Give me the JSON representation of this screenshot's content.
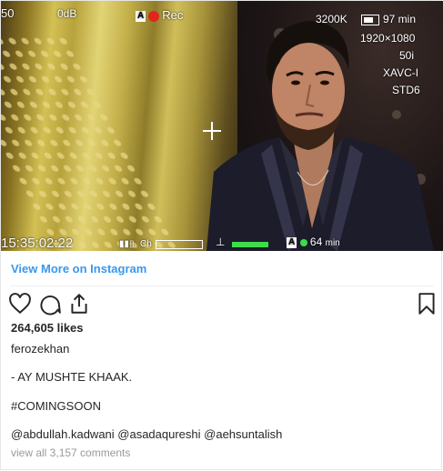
{
  "hud": {
    "top_left_value": "50",
    "audio_level": "0dB",
    "rec_badge": "A",
    "rec_label": "Rec",
    "white_balance": "3200K",
    "battery_time": "97 min",
    "resolution": "1920×1080",
    "frame_rate": "50i",
    "codec": "XAVC-I",
    "picture_profile": "STD6",
    "timecode": "15:35:02:22",
    "channel_label": "Ch",
    "media_badge": "A",
    "media_time": "64",
    "media_unit": "min"
  },
  "link": {
    "view_more": "View More on Instagram"
  },
  "icons": {
    "like": "heart-icon",
    "comment": "comment-icon",
    "share": "share-icon",
    "save": "bookmark-icon"
  },
  "post": {
    "likes": "264,605 likes",
    "author": "ferozekhan",
    "caption_line1": "- AY MUSHTE KHAAK.",
    "caption_line2": "#COMINGSOON",
    "caption_line3": "@abdullah.kadwani @asadaqureshi @aehsuntalish",
    "view_comments": "view all 3,157 comments"
  },
  "colors": {
    "link": "#3897f0",
    "text": "#262626",
    "muted": "#999999",
    "rec": "#e0251b",
    "meter": "#3ddc4a"
  }
}
